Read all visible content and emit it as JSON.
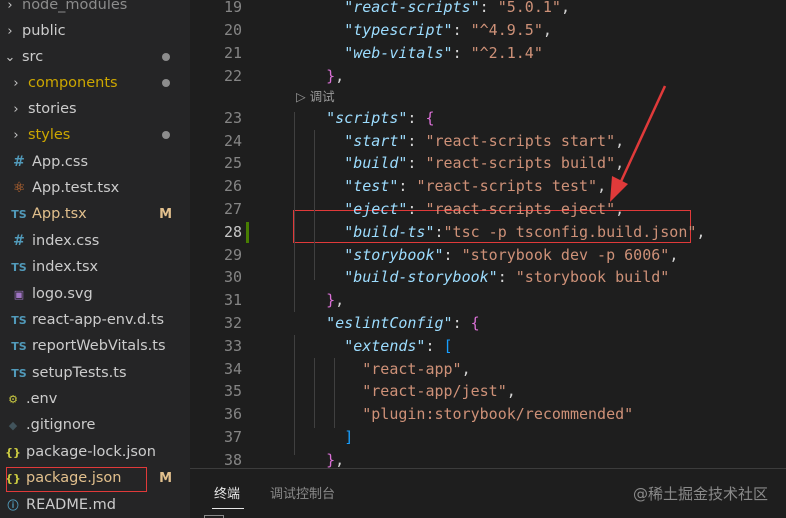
{
  "explorer": {
    "items": [
      {
        "label": "node_modules",
        "kind": "folder",
        "chevron": "›",
        "color": "#8c8c8c"
      },
      {
        "label": "public",
        "kind": "folder",
        "chevron": "›",
        "color": "#cccccc"
      },
      {
        "label": "src",
        "kind": "folder-open",
        "chevron": "⌄",
        "color": "#cccccc",
        "dot": true
      },
      {
        "label": "components",
        "kind": "folder",
        "chevron": "›",
        "color": "#cca700",
        "dot": true
      },
      {
        "label": "stories",
        "kind": "folder",
        "chevron": "›",
        "color": "#cccccc"
      },
      {
        "label": "styles",
        "kind": "folder",
        "chevron": "›",
        "color": "#cca700",
        "dot": true
      },
      {
        "label": "App.css",
        "kind": "file",
        "icon": "#",
        "icon_class": "icon-hash",
        "color": "#cccccc"
      },
      {
        "label": "App.test.tsx",
        "kind": "file",
        "icon": "⚛",
        "icon_class": "icon-react",
        "color": "#cccccc"
      },
      {
        "label": "App.tsx",
        "kind": "file",
        "icon": "TS",
        "icon_class": "icon-ts",
        "color": "#e2c08d",
        "badge": "M"
      },
      {
        "label": "index.css",
        "kind": "file",
        "icon": "#",
        "icon_class": "icon-hash",
        "color": "#cccccc"
      },
      {
        "label": "index.tsx",
        "kind": "file",
        "icon": "TS",
        "icon_class": "icon-ts",
        "color": "#cccccc"
      },
      {
        "label": "logo.svg",
        "kind": "file",
        "icon": "▣",
        "icon_class": "icon-svg",
        "color": "#cccccc"
      },
      {
        "label": "react-app-env.d.ts",
        "kind": "file",
        "icon": "TS",
        "icon_class": "icon-ts",
        "color": "#cccccc"
      },
      {
        "label": "reportWebVitals.ts",
        "kind": "file",
        "icon": "TS",
        "icon_class": "icon-ts",
        "color": "#cccccc"
      },
      {
        "label": "setupTests.ts",
        "kind": "file",
        "icon": "TS",
        "icon_class": "icon-ts",
        "color": "#cccccc"
      },
      {
        "label": ".env",
        "kind": "file",
        "icon": "⚙",
        "icon_class": "icon-env",
        "color": "#cccccc"
      },
      {
        "label": ".gitignore",
        "kind": "file",
        "icon": "◆",
        "icon_class": "icon-git",
        "color": "#cccccc"
      },
      {
        "label": "package-lock.json",
        "kind": "file",
        "icon": "{}",
        "icon_class": "icon-json",
        "color": "#cccccc"
      },
      {
        "label": "package.json",
        "kind": "file",
        "icon": "{}",
        "icon_class": "icon-json",
        "color": "#e2c08d",
        "badge": "M"
      },
      {
        "label": "README.md",
        "kind": "file",
        "icon": "ⓘ",
        "icon_class": "icon-info",
        "color": "#cccccc"
      }
    ]
  },
  "editor": {
    "codelens": "调试",
    "lines": [
      {
        "num": "19",
        "tokens": [
          {
            "t": "      ",
            "c": "p"
          },
          {
            "t": "\"react-scripts\"",
            "c": "k"
          },
          {
            "t": ": ",
            "c": "p"
          },
          {
            "t": "\"5.0.1\"",
            "c": "s"
          },
          {
            "t": ",",
            "c": "p"
          }
        ]
      },
      {
        "num": "20",
        "tokens": [
          {
            "t": "      ",
            "c": "p"
          },
          {
            "t": "\"typescript\"",
            "c": "k"
          },
          {
            "t": ": ",
            "c": "p"
          },
          {
            "t": "\"^4.9.5\"",
            "c": "s"
          },
          {
            "t": ",",
            "c": "p"
          }
        ]
      },
      {
        "num": "21",
        "tokens": [
          {
            "t": "      ",
            "c": "p"
          },
          {
            "t": "\"web-vitals\"",
            "c": "k"
          },
          {
            "t": ": ",
            "c": "p"
          },
          {
            "t": "\"^2.1.4\"",
            "c": "s"
          }
        ]
      },
      {
        "num": "22",
        "tokens": [
          {
            "t": "    ",
            "c": "p"
          },
          {
            "t": "}",
            "c": "b1"
          },
          {
            "t": ",",
            "c": "p"
          }
        ]
      },
      {
        "num": "23",
        "tokens": [
          {
            "t": "    ",
            "c": "p"
          },
          {
            "t": "\"scripts\"",
            "c": "k"
          },
          {
            "t": ": ",
            "c": "p"
          },
          {
            "t": "{",
            "c": "b1"
          }
        ]
      },
      {
        "num": "24",
        "tokens": [
          {
            "t": "      ",
            "c": "p"
          },
          {
            "t": "\"start\"",
            "c": "k"
          },
          {
            "t": ": ",
            "c": "p"
          },
          {
            "t": "\"react-scripts start\"",
            "c": "s"
          },
          {
            "t": ",",
            "c": "p"
          }
        ]
      },
      {
        "num": "25",
        "tokens": [
          {
            "t": "      ",
            "c": "p"
          },
          {
            "t": "\"build\"",
            "c": "k"
          },
          {
            "t": ": ",
            "c": "p"
          },
          {
            "t": "\"react-scripts build\"",
            "c": "s"
          },
          {
            "t": ",",
            "c": "p"
          }
        ]
      },
      {
        "num": "26",
        "tokens": [
          {
            "t": "      ",
            "c": "p"
          },
          {
            "t": "\"test\"",
            "c": "k"
          },
          {
            "t": ": ",
            "c": "p"
          },
          {
            "t": "\"react-scripts test\"",
            "c": "s"
          },
          {
            "t": ",",
            "c": "p"
          }
        ]
      },
      {
        "num": "27",
        "tokens": [
          {
            "t": "      ",
            "c": "p"
          },
          {
            "t": "\"eject\"",
            "c": "k"
          },
          {
            "t": ": ",
            "c": "p"
          },
          {
            "t": "\"react-scripts eject\"",
            "c": "s"
          },
          {
            "t": ",",
            "c": "p"
          }
        ]
      },
      {
        "num": "28",
        "tokens": [
          {
            "t": "      ",
            "c": "p"
          },
          {
            "t": "\"build-ts\"",
            "c": "k"
          },
          {
            "t": ":",
            "c": "p"
          },
          {
            "t": "\"tsc -p tsconfig.build.json\"",
            "c": "s"
          },
          {
            "t": ",",
            "c": "p"
          }
        ],
        "active": true
      },
      {
        "num": "29",
        "tokens": [
          {
            "t": "      ",
            "c": "p"
          },
          {
            "t": "\"storybook\"",
            "c": "k"
          },
          {
            "t": ": ",
            "c": "p"
          },
          {
            "t": "\"storybook dev -p 6006\"",
            "c": "s"
          },
          {
            "t": ",",
            "c": "p"
          }
        ]
      },
      {
        "num": "30",
        "tokens": [
          {
            "t": "      ",
            "c": "p"
          },
          {
            "t": "\"build-storybook\"",
            "c": "k"
          },
          {
            "t": ": ",
            "c": "p"
          },
          {
            "t": "\"storybook build\"",
            "c": "s"
          }
        ]
      },
      {
        "num": "31",
        "tokens": [
          {
            "t": "    ",
            "c": "p"
          },
          {
            "t": "}",
            "c": "b1"
          },
          {
            "t": ",",
            "c": "p"
          }
        ]
      },
      {
        "num": "32",
        "tokens": [
          {
            "t": "    ",
            "c": "p"
          },
          {
            "t": "\"eslintConfig\"",
            "c": "k"
          },
          {
            "t": ": ",
            "c": "p"
          },
          {
            "t": "{",
            "c": "b1"
          }
        ]
      },
      {
        "num": "33",
        "tokens": [
          {
            "t": "      ",
            "c": "p"
          },
          {
            "t": "\"extends\"",
            "c": "k"
          },
          {
            "t": ": ",
            "c": "p"
          },
          {
            "t": "[",
            "c": "b2"
          }
        ]
      },
      {
        "num": "34",
        "tokens": [
          {
            "t": "        ",
            "c": "p"
          },
          {
            "t": "\"react-app\"",
            "c": "s"
          },
          {
            "t": ",",
            "c": "p"
          }
        ]
      },
      {
        "num": "35",
        "tokens": [
          {
            "t": "        ",
            "c": "p"
          },
          {
            "t": "\"react-app/jest\"",
            "c": "s"
          },
          {
            "t": ",",
            "c": "p"
          }
        ]
      },
      {
        "num": "36",
        "tokens": [
          {
            "t": "        ",
            "c": "p"
          },
          {
            "t": "\"plugin:storybook/recommended\"",
            "c": "s"
          }
        ]
      },
      {
        "num": "37",
        "tokens": [
          {
            "t": "      ",
            "c": "p"
          },
          {
            "t": "]",
            "c": "b2"
          }
        ]
      },
      {
        "num": "38",
        "tokens": [
          {
            "t": "    ",
            "c": "p"
          },
          {
            "t": "}",
            "c": "b1"
          },
          {
            "t": ",",
            "c": "p"
          }
        ]
      }
    ]
  },
  "panel": {
    "tabs": [
      {
        "label": "终端",
        "active": true
      },
      {
        "label": "调试控制台",
        "active": false
      }
    ],
    "watermark": "@稀土掘金技术社区"
  },
  "colors": {
    "annotation_red": "#e03a3a",
    "modified_badge": "#e2c08d",
    "git_added_bar": "#487e02"
  }
}
